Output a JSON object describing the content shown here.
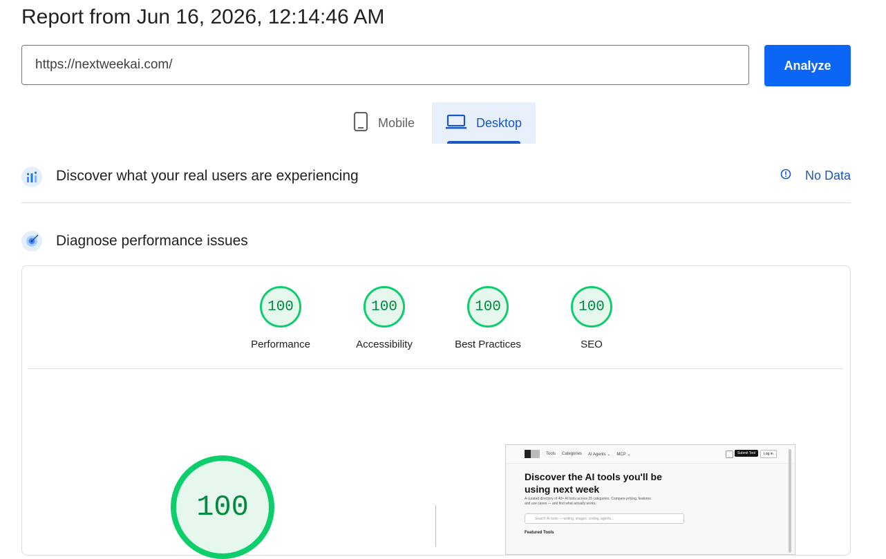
{
  "header": {
    "title": "Report from Jun 16, 2026, 12:14:46 AM"
  },
  "url_bar": {
    "value": "https://nextweekai.com/",
    "analyze_label": "Analyze"
  },
  "tabs": [
    {
      "label": "Mobile",
      "icon": "smartphone-icon",
      "selected": false
    },
    {
      "label": "Desktop",
      "icon": "laptop-icon",
      "selected": true
    }
  ],
  "crux": {
    "title": "Discover what your real users are experiencing",
    "status": "No Data"
  },
  "diagnose": {
    "title": "Diagnose performance issues"
  },
  "scores": [
    {
      "label": "Performance",
      "value": "100"
    },
    {
      "label": "Accessibility",
      "value": "100"
    },
    {
      "label": "Best Practices",
      "value": "100"
    },
    {
      "label": "SEO",
      "value": "100"
    }
  ],
  "main_score": {
    "value": "100"
  },
  "preview": {
    "nav": [
      "Tools",
      "Categories",
      "AI Agents ⌄",
      "MCP ⌄"
    ],
    "submit": "Submit Tool",
    "login": "Log in",
    "hero": "Discover the AI tools you'll be using next week",
    "desc": "A curated directory of 40+ AI tools across 25 categories. Compare pricing, features and use cases — and find what actually works.",
    "search_placeholder": "Search AI tools — writing, images, coding, agents...",
    "featured": "Featured Tools"
  },
  "colors": {
    "accent": "#1a56c4",
    "button": "#0b66f5",
    "pass": "#0cce6b",
    "pass_text": "#008a3e"
  }
}
